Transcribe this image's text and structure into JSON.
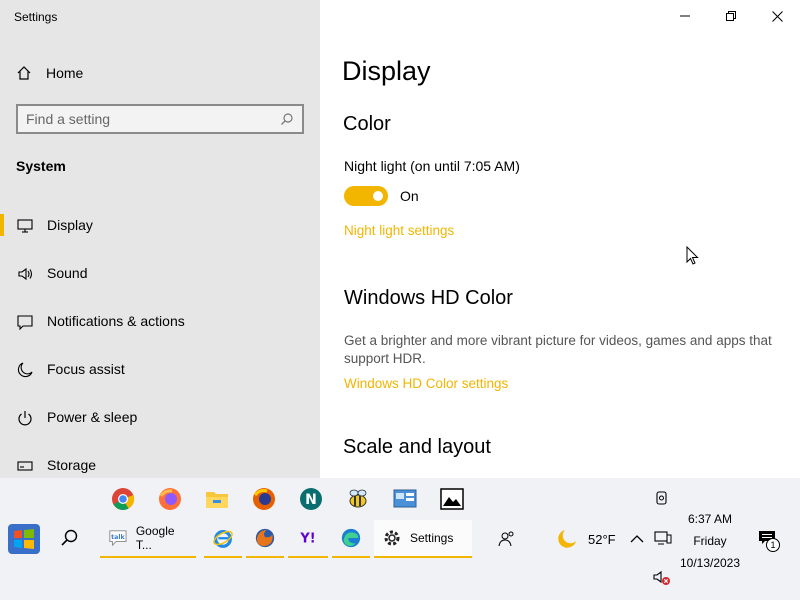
{
  "window": {
    "app_title": "Settings",
    "controls": {
      "minimize": "minimize-icon",
      "restore": "restore-icon",
      "close": "close-icon"
    }
  },
  "sidebar": {
    "home_label": "Home",
    "search_placeholder": "Find a setting",
    "section": "System",
    "items": [
      {
        "label": "Display",
        "icon": "monitor-icon",
        "active": true
      },
      {
        "label": "Sound",
        "icon": "speaker-icon"
      },
      {
        "label": "Notifications & actions",
        "icon": "notification-icon"
      },
      {
        "label": "Focus assist",
        "icon": "moon-icon"
      },
      {
        "label": "Power & sleep",
        "icon": "power-icon"
      },
      {
        "label": "Storage",
        "icon": "storage-icon"
      }
    ]
  },
  "main": {
    "title": "Display",
    "color_heading": "Color",
    "night_light_label": "Night light (on until 7:05 AM)",
    "toggle_state": "On",
    "night_light_link": "Night light settings",
    "hd_heading": "Windows HD Color",
    "hd_description": "Get a brighter and more vibrant picture for videos, games and apps that support HDR.",
    "hd_link": "Windows HD Color settings",
    "scale_heading": "Scale and layout"
  },
  "colors": {
    "accent": "#f2b500",
    "sidebar_bg": "#e6e6e6",
    "taskbar_bg": "#f0f2f5"
  },
  "taskbar": {
    "pinned_row": [
      "chrome-icon",
      "firefox-icon",
      "file-explorer-icon",
      "firefox-dev-icon",
      "netscape-icon",
      "bee-app-icon",
      "control-panel-icon",
      "image-viewer-icon"
    ],
    "apps": [
      {
        "label": "Google T...",
        "icon": "google-talk-icon"
      },
      {
        "label": "",
        "icon": "internet-explorer-icon"
      },
      {
        "label": "",
        "icon": "firefox-old-icon"
      },
      {
        "label": "",
        "icon": "yahoo-icon"
      },
      {
        "label": "",
        "icon": "edge-icon"
      },
      {
        "label": "Settings",
        "icon": "gear-icon"
      },
      {
        "label": "",
        "icon": "people-icon"
      }
    ],
    "weather": "52°F",
    "time": "6:37 AM",
    "day": "Friday",
    "date": "10/13/2023",
    "notification_count": "1"
  }
}
